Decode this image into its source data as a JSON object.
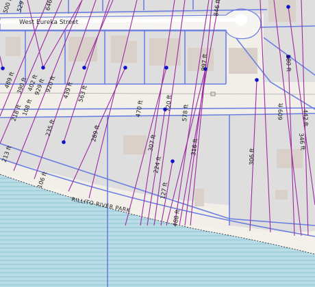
{
  "map": {
    "street_label": "West Eureka Street",
    "park_label": "RILLITO RIVER PARK",
    "colors": {
      "land": "#f2efe9",
      "parcel": "#dddddd",
      "building": "#d9d0c9",
      "river": "#aad3df",
      "parcel_line": "#6b7fe0",
      "measure_line": "#9c2aa0",
      "point": "#1010c8"
    },
    "distances": [
      {
        "label": "500 ft"
      },
      {
        "label": "529 ft"
      },
      {
        "label": "646 ft"
      },
      {
        "label": "846 ft"
      },
      {
        "label": "489 ft"
      },
      {
        "label": "390 ft"
      },
      {
        "label": "402 ft"
      },
      {
        "label": "929 ft"
      },
      {
        "label": "920 ft"
      },
      {
        "label": "439 ft"
      },
      {
        "label": "563 ft"
      },
      {
        "label": "218 ft"
      },
      {
        "label": "108 ft"
      },
      {
        "label": "235 ft"
      },
      {
        "label": "289 ft"
      },
      {
        "label": "470 ft"
      },
      {
        "label": "720 ft"
      },
      {
        "label": "578 ft"
      },
      {
        "label": "997 ft"
      },
      {
        "label": "580 ft"
      },
      {
        "label": "609 ft"
      },
      {
        "label": "442 ft"
      },
      {
        "label": "346 ft"
      },
      {
        "label": "307 ft"
      },
      {
        "label": "224 ft"
      },
      {
        "label": "316 ft"
      },
      {
        "label": "306 ft"
      },
      {
        "label": "127 ft"
      },
      {
        "label": "488 ft"
      },
      {
        "label": "106 ft"
      },
      {
        "label": "213 ft"
      }
    ]
  }
}
